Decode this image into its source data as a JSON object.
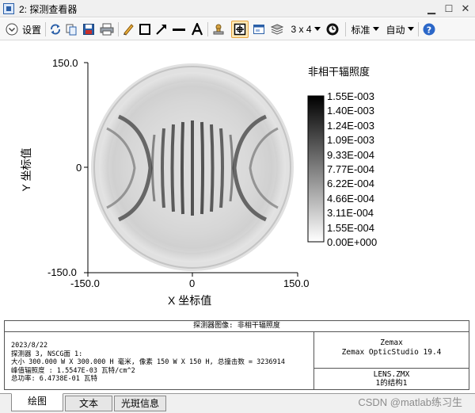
{
  "window": {
    "title": "2: 探测查看器"
  },
  "toolbar": {
    "settings_label": "设置",
    "layout_label": "3 x 4",
    "standard_label": "标准",
    "auto_label": "自动"
  },
  "legend": {
    "title": "非相干辐照度",
    "values": [
      "1.55E-003",
      "1.40E-003",
      "1.24E-003",
      "1.09E-003",
      "9.33E-004",
      "7.77E-004",
      "6.22E-004",
      "4.66E-004",
      "3.11E-004",
      "1.55E-004",
      "0.00E+000"
    ]
  },
  "chart_data": {
    "type": "heatmap",
    "xlabel": "X 坐标值",
    "ylabel": "Y 坐标值",
    "xlim": [
      -150.0,
      150.0
    ],
    "ylim": [
      -150.0,
      150.0
    ],
    "x_ticks": [
      "-150.0",
      "0",
      "150.0"
    ],
    "y_ticks": [
      "150.0",
      "0",
      "-150.0"
    ],
    "colorbar_range": [
      0.0,
      0.00155
    ],
    "colormap": "inverted-grayscale"
  },
  "info": {
    "title": "探测器图像: 非相干辐照度",
    "lines": [
      "2023/8/22",
      "探测器 3, NSCG面 1:",
      "大小 300.000 W X 300.000 H 毫米, 像素 150 W X 150 H, 总撞击数 = 3236914",
      "峰值辐照度 : 1.5547E-03 瓦特/cm^2",
      "总功率: 6.4738E-01 瓦特"
    ],
    "program_lines": [
      "Zemax",
      "Zemax OpticStudio 19.4"
    ],
    "file_lines": [
      "LENS.ZMX",
      "1的结构1"
    ]
  },
  "tabs": [
    {
      "label": "绘图"
    },
    {
      "label": "文本"
    },
    {
      "label": "光斑信息"
    }
  ],
  "watermark": "CSDN @matlab练习生",
  "colors": {
    "toolbar_icon_blue": "#2a5fa8",
    "active_tool_bg": "#fde9b6",
    "help_blue": "#2b67c8"
  }
}
